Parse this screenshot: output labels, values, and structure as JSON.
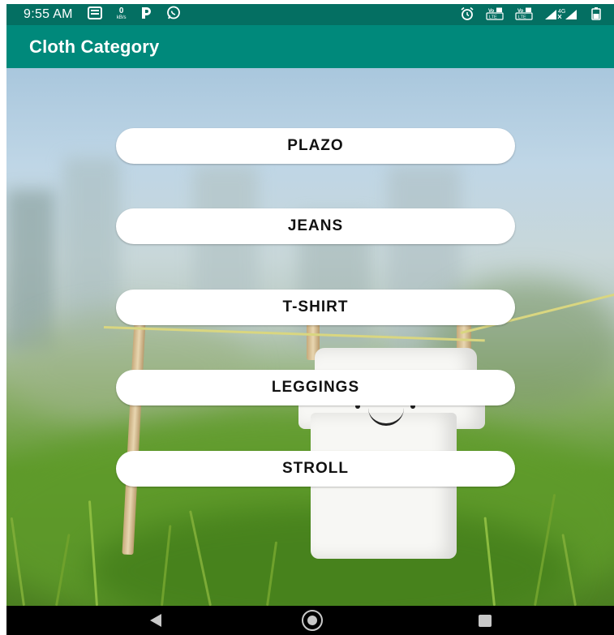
{
  "status_bar": {
    "time": "9:55 AM",
    "left_icons": [
      "notes-icon",
      "data-speed-icon",
      "parking-icon",
      "whatsapp-icon"
    ],
    "data_speed_value": "0",
    "data_speed_unit": "kB/s",
    "right_icons": [
      "alarm-icon",
      "volte-sim1-icon",
      "volte-sim2-icon",
      "signal-icon",
      "battery-icon"
    ],
    "volte_label": "VoLTE",
    "network_label": "4G"
  },
  "app_bar": {
    "title": "Cloth Category",
    "color": "#00897b",
    "status_color": "#046f62"
  },
  "categories": [
    {
      "label": "PLAZO"
    },
    {
      "label": "JEANS"
    },
    {
      "label": "T-SHIRT"
    },
    {
      "label": "LEGGINGS"
    },
    {
      "label": "STROLL"
    }
  ],
  "nav_bar": {
    "icons": [
      "back-icon",
      "home-icon",
      "recents-icon"
    ]
  }
}
